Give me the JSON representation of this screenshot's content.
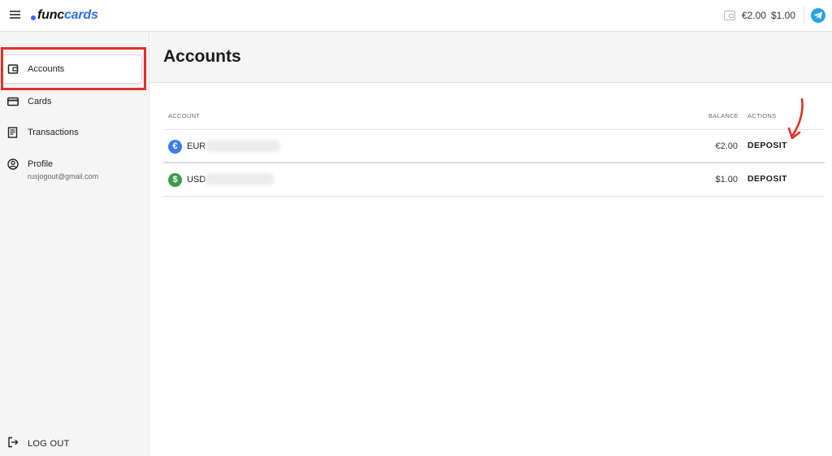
{
  "brand": {
    "func": "func",
    "cards": "cards",
    "accent": "#2f6ff0"
  },
  "header": {
    "wallet_icon": "wallet-icon",
    "eur_balance": "€2.00",
    "usd_balance": "$1.00",
    "telegram_icon": "telegram-icon"
  },
  "sidebar": {
    "items": [
      {
        "label": "Accounts",
        "icon": "wallet-icon",
        "active": true
      },
      {
        "label": "Cards",
        "icon": "credit-card-icon"
      },
      {
        "label": "Transactions",
        "icon": "receipt-icon"
      },
      {
        "label": "Profile",
        "icon": "user-circle-icon"
      }
    ],
    "profile_email": "rusjogout@gmail.com",
    "logout_label": "LOG OUT"
  },
  "main": {
    "title": "Accounts",
    "table": {
      "headers": {
        "account": "ACCOUNT",
        "balance": "BALANCE",
        "actions": "ACTIONS"
      },
      "rows": [
        {
          "currency": "EUR",
          "symbol": "€",
          "color": "#3b7de6",
          "balance": "€2.00",
          "action": "DEPOSIT"
        },
        {
          "currency": "USD",
          "symbol": "$",
          "color": "#3c9a4f",
          "balance": "$1.00",
          "action": "DEPOSIT"
        }
      ]
    }
  },
  "highlight_color": "#e03128"
}
